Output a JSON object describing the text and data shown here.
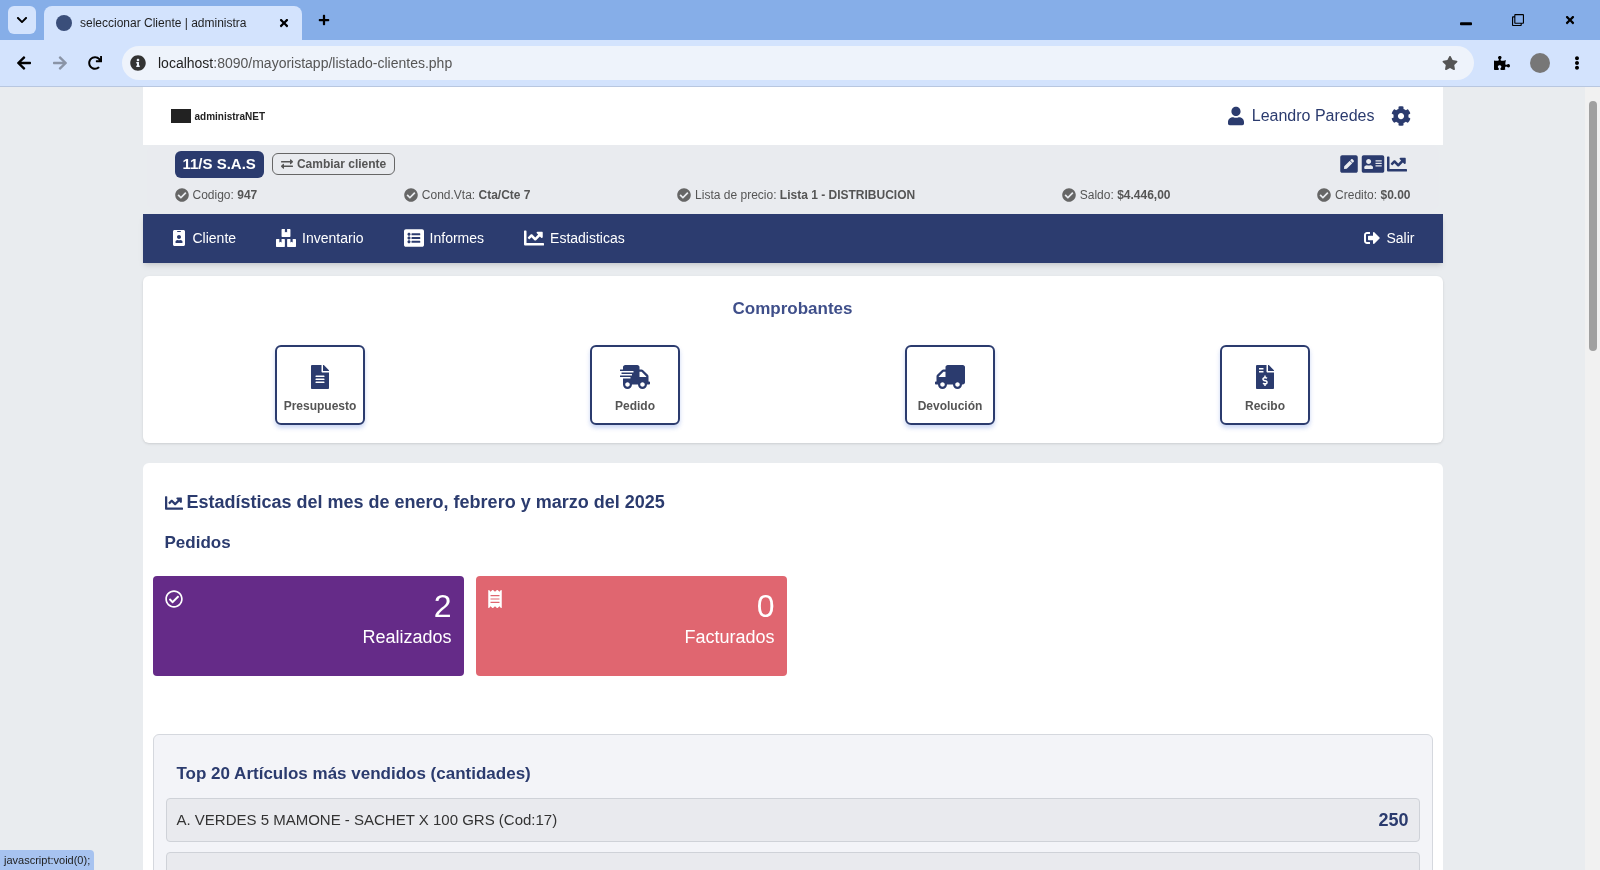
{
  "browser": {
    "tab_title": "seleccionar Cliente | administra",
    "url_host": "localhost",
    "url_path": ":8090/mayoristapp/listado-clientes.php",
    "status_text": "javascript:void(0);"
  },
  "header": {
    "logo_text": "administraNET",
    "user_name": "Leandro Paredes"
  },
  "client": {
    "name": "11/S S.A.S",
    "change_button": "Cambiar cliente",
    "fields": [
      {
        "label": "Codigo:",
        "value": "947"
      },
      {
        "label": "Cond.Vta:",
        "value": "Cta/Cte 7"
      },
      {
        "label": "Lista de precio:",
        "value": "Lista 1 - DISTRIBUCION"
      },
      {
        "label": "Saldo:",
        "value": "$4.446,00"
      },
      {
        "label": "Credito:",
        "value": "$0.00"
      }
    ]
  },
  "nav": {
    "items": [
      {
        "label": "Cliente"
      },
      {
        "label": "Inventario"
      },
      {
        "label": "Informes"
      },
      {
        "label": "Estadisticas"
      }
    ],
    "exit": "Salir"
  },
  "comprobantes": {
    "title": "Comprobantes",
    "buttons": [
      {
        "label": "Presupuesto"
      },
      {
        "label": "Pedido"
      },
      {
        "label": "Devolución"
      },
      {
        "label": "Recibo"
      }
    ]
  },
  "stats": {
    "title": "Estadísticas del mes de enero, febrero y marzo del 2025",
    "subtitle": "Pedidos",
    "cards": [
      {
        "value": "2",
        "label": "Realizados",
        "color": "#652b88"
      },
      {
        "value": "0",
        "label": "Facturados",
        "color": "#e06670"
      }
    ],
    "top": {
      "title": "Top 20 Artículos más vendidos (cantidades)",
      "rows": [
        {
          "name": "A. VERDES 5 MAMONE - SACHET X 100 GRS (Cod:17)",
          "qty": "250"
        }
      ]
    }
  }
}
